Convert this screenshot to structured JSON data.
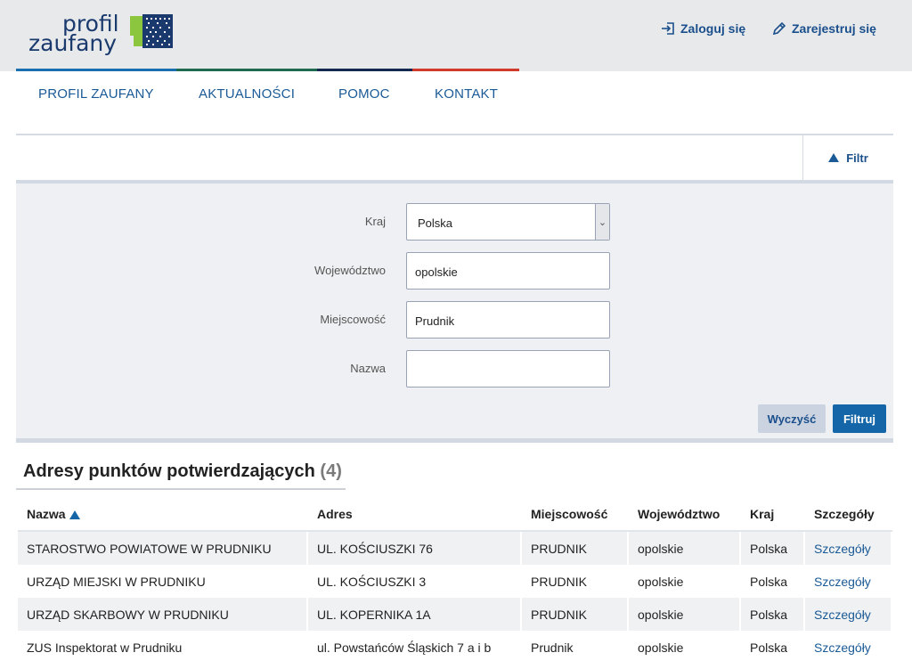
{
  "logo": {
    "line1": "profil",
    "line2": "zaufany"
  },
  "auth": {
    "login_label": "Zaloguj się",
    "register_label": "Zarejestruj się"
  },
  "nav": {
    "items": [
      "PROFIL ZAUFANY",
      "AKTUALNOŚCI",
      "POMOC",
      "KONTAKT"
    ]
  },
  "filter": {
    "toggle_label": "Filtr",
    "fields": {
      "country": {
        "label": "Kraj",
        "value": "Polska"
      },
      "voivodeship": {
        "label": "Województwo",
        "value": "opolskie"
      },
      "city": {
        "label": "Miejscowość",
        "value": "Prudnik"
      },
      "name": {
        "label": "Nazwa",
        "value": ""
      }
    },
    "clear_label": "Wyczyść",
    "submit_label": "Filtruj"
  },
  "results": {
    "title": "Adresy punktów potwierdzających",
    "count": "(4)",
    "columns": [
      "Nazwa",
      "Adres",
      "Miejscowość",
      "Województwo",
      "Kraj",
      "Szczegóły"
    ],
    "rows": [
      [
        "STAROSTWO POWIATOWE W PRUDNIKU",
        "UL. KOŚCIUSZKI 76",
        "PRUDNIK",
        "opolskie",
        "Polska",
        "Szczegóły"
      ],
      [
        "URZĄD MIEJSKI W PRUDNIKU",
        "UL. KOŚCIUSZKI 3",
        "PRUDNIK",
        "opolskie",
        "Polska",
        "Szczegóły"
      ],
      [
        "URZĄD SKARBOWY W PRUDNIKU",
        "UL. KOPERNIKA 1A",
        "PRUDNIK",
        "opolskie",
        "Polska",
        "Szczegóły"
      ],
      [
        "ZUS Inspektorat w Prudniku",
        "ul. Powstańców Śląskich 7 a i b",
        "Prudnik",
        "opolskie",
        "Polska",
        "Szczegóły"
      ]
    ]
  },
  "colors": {
    "brand_blue": "#1a4f8c",
    "accent_line_1": "#1a6fb0",
    "accent_line_2": "#1e6b52",
    "accent_line_3": "#14294f",
    "accent_line_4": "#d03a2a"
  }
}
